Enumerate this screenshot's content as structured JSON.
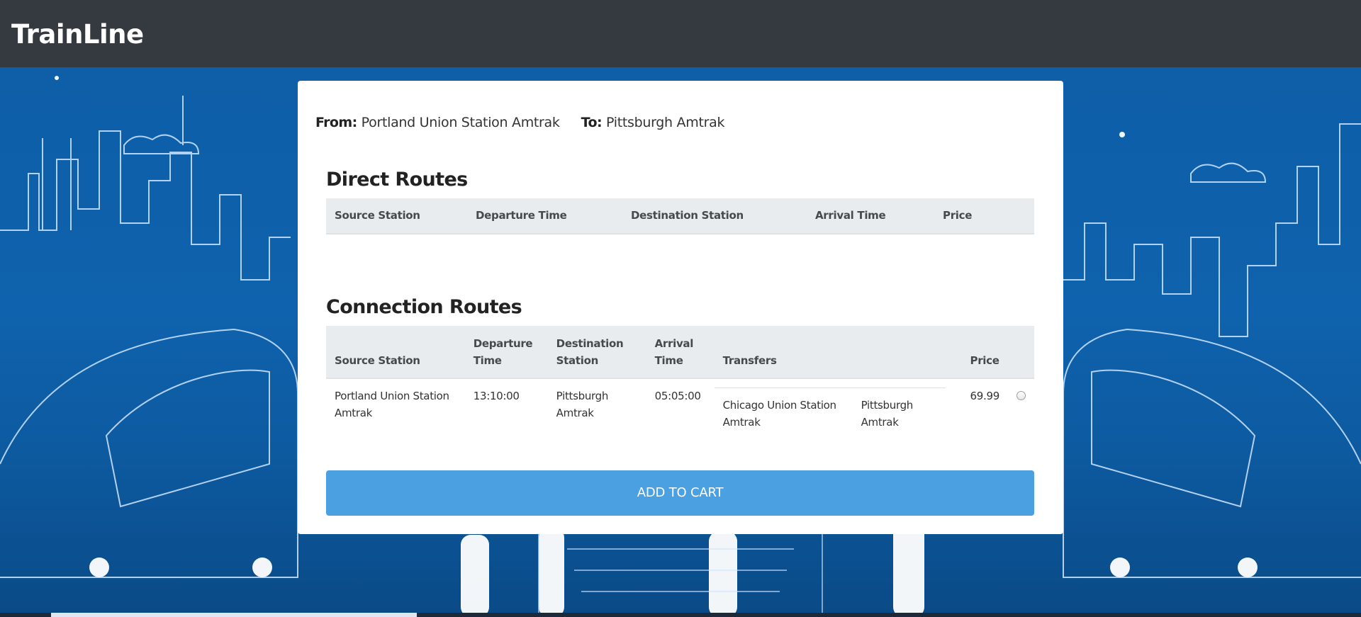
{
  "app": {
    "brand": "TrainLine"
  },
  "search": {
    "from_label": "From:",
    "from_value": "Portland Union Station Amtrak",
    "to_label": "To:",
    "to_value": "Pittsburgh Amtrak"
  },
  "direct_routes": {
    "title": "Direct Routes",
    "columns": [
      "Source Station",
      "Departure Time",
      "Destination Station",
      "Arrival Time",
      "Price"
    ],
    "rows": []
  },
  "connection_routes": {
    "title": "Connection Routes",
    "columns": [
      "Source Station",
      "Departure Time",
      "Destination Station",
      "Arrival Time",
      "Transfers",
      "Price"
    ],
    "rows": [
      {
        "source": "Portland Union Station Amtrak",
        "departure": "13:10:00",
        "destination": "Pittsburgh Amtrak",
        "arrival": "05:05:00",
        "transfers": [
          {
            "station": "Chicago Union Station Amtrak",
            "destination": "Pittsburgh Amtrak"
          }
        ],
        "price": "69.99",
        "selected": false
      }
    ]
  },
  "actions": {
    "add_to_cart": "ADD TO CART"
  },
  "colors": {
    "navbar": "#343a40",
    "button": "#4aa0e0",
    "table_header": "#e9ecef",
    "background": "#0f62ad"
  }
}
